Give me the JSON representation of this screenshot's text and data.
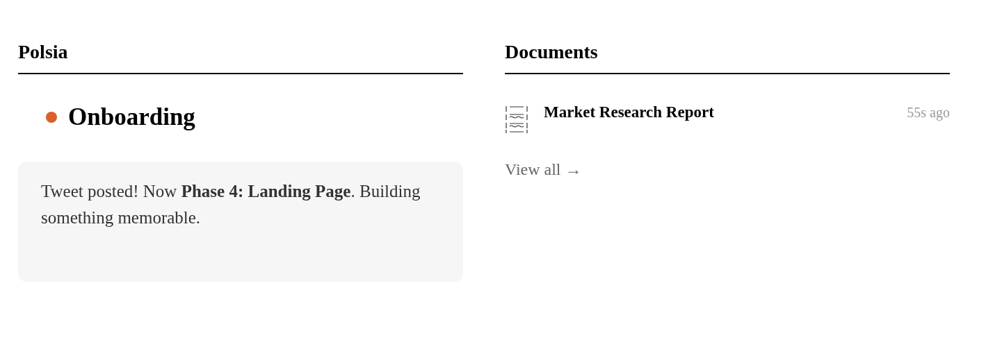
{
  "left": {
    "title": "Polsia",
    "status": {
      "label": "Onboarding"
    },
    "message": "Tweet posted! Now **Phase 4: Landing Page**. Building something memorable."
  },
  "right": {
    "title": "Documents",
    "documents": [
      {
        "title": "Market Research Report",
        "time": "55s ago"
      }
    ],
    "link": "View all →"
  }
}
